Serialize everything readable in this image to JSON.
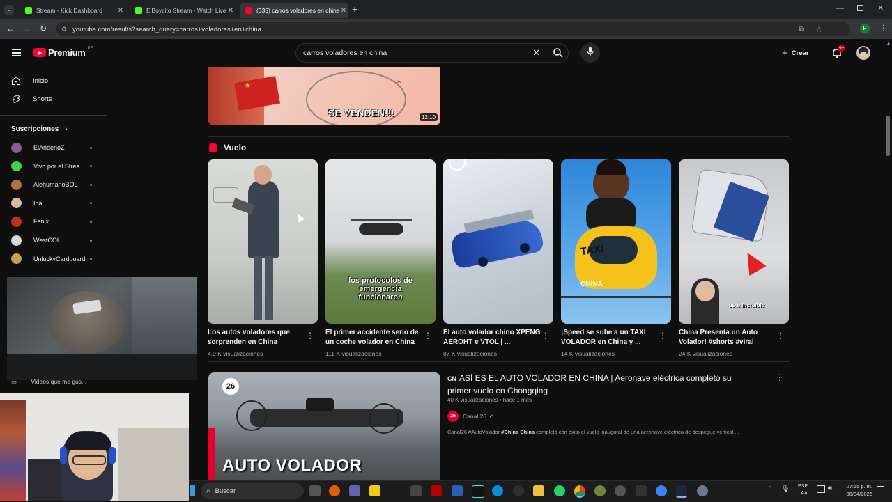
{
  "browser": {
    "tabs": [
      {
        "title": "Stream - Kick Dashboard",
        "active": false
      },
      {
        "title": "ElBoycito Stream - Watch Live o",
        "active": false
      },
      {
        "title": "(335) carros voladores en china",
        "active": true
      }
    ],
    "url": "youtube.com/results?search_query=carros+voladores+en+china"
  },
  "header": {
    "brand": "Premium",
    "region": "PE",
    "search_value": "carros voladores en china",
    "create_label": "Crear",
    "notif_badge": "9+"
  },
  "sidebar": {
    "items": [
      {
        "label": "Inicio",
        "icon": "home-icon"
      },
      {
        "label": "Shorts",
        "icon": "shorts-icon"
      }
    ],
    "subs_title": "Suscripciones",
    "subs": [
      {
        "name": "ElAndenoZ",
        "color": "#8a5a9a"
      },
      {
        "name": "Vivo por el Strea...",
        "color": "#3fd13f"
      },
      {
        "name": "AlehumanoBOL",
        "color": "#b07040"
      },
      {
        "name": "Ibai",
        "color": "#d9b99a"
      },
      {
        "name": "Fenix",
        "color": "#c03020"
      },
      {
        "name": "WestCOL",
        "color": "#d8d8d8"
      },
      {
        "name": "UnluckyCardboard",
        "color": "#c8a050"
      }
    ],
    "liked_label": "Videos que me gus..."
  },
  "top_video": {
    "duration": "12:10",
    "overlay": "SE VENDEN!!!"
  },
  "shelf": {
    "title": "Vuelo",
    "items": [
      {
        "title": "Los autos voladores que sorprenden en China",
        "views": "4,9 K visualizaciones"
      },
      {
        "title": "El primer accidente serio de un coche volador en China",
        "views": "111 K visualizaciones",
        "caption": "los protocolos de emergencia funcionaron"
      },
      {
        "title": "El auto volador chino XPENG AEROHT e VTOL | ...",
        "views": "87 K visualizaciones"
      },
      {
        "title": "¡Speed se sube a un TAXI VOLADOR en China y ...",
        "views": "14 K visualizaciones",
        "sign_taxi": "TAXI",
        "sign_china": "CHINA"
      },
      {
        "title": "China Presenta un Auto Volador! #shorts #viral",
        "views": "24 K visualizaciones",
        "caption": "este increíble"
      }
    ]
  },
  "result": {
    "prefix": "CN",
    "title": "ASÍ ES EL AUTO VOLADOR EN CHINA | Aeronave eléctrica completó su primer vuelo en Chongqing",
    "meta": "40 K visualizaciones • hace 1 mes",
    "channel": "Canal 26",
    "channel_badge": "26",
    "desc_a": "Canal26 #AutoVolador ",
    "desc_b": "#China China",
    "desc_c": " completó con éxito el vuelo inaugural de una aeronave eléctrica de despegue vertical ...",
    "thumb_text": "AUTO VOLADOR",
    "thumb_badge": "26"
  },
  "taskbar": {
    "search": "Buscar",
    "lang1": "ESP",
    "lang2": "LAA",
    "time": "07:55 p. m.",
    "date": "06/04/2026"
  },
  "colors": {
    "accent": "#ff0033",
    "link": "#3ea6ff"
  }
}
